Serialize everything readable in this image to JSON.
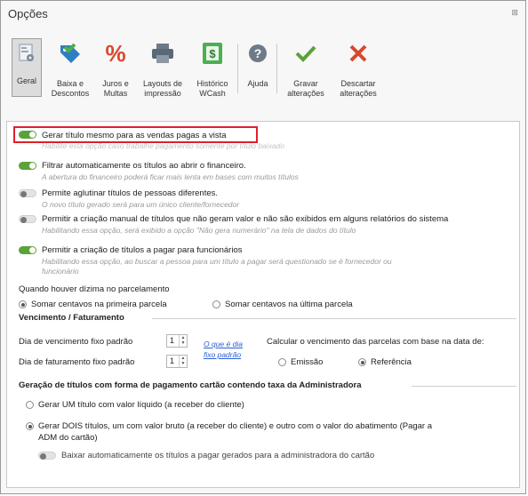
{
  "window": {
    "title": "Opções",
    "close_glyph": "⊠"
  },
  "toolbar": {
    "buttons": [
      {
        "label": "Geral",
        "icon": "general-settings-icon"
      },
      {
        "label": "Baixa e\nDescontos",
        "icon": "discount-tag-icon"
      },
      {
        "label": "Juros e\nMultas",
        "icon": "percent-icon"
      },
      {
        "label": "Layouts de\nimpressão",
        "icon": "printer-icon"
      },
      {
        "label": "Histórico\nWCash",
        "icon": "wcash-icon"
      },
      {
        "label": "Ajuda",
        "icon": "help-icon"
      },
      {
        "label": "Gravar\nalterações",
        "icon": "checkmark-icon"
      },
      {
        "label": "Descartar\nalterações",
        "icon": "cancel-x-icon"
      }
    ]
  },
  "options": [
    {
      "label": "Gerar título mesmo para as vendas pagas a vista",
      "hint": "Habilite esta opção caso trabalhe pagamento somente por título baixado",
      "on": true
    },
    {
      "label": "Filtrar automaticamente os títulos ao abrir o financeiro.",
      "hint": "A abertura do financeiro poderá ficar mais lenta em bases com muitos títulos",
      "on": true
    },
    {
      "label": "Permite aglutinar títulos de pessoas diferentes.",
      "hint": "O novo título gerado será para um único cliente/fornecedor",
      "on": false
    },
    {
      "label": "Permitir a criação manual de títulos que não geram valor e não são exibidos em alguns relatórios do sistema",
      "hint": "Habilitando essa opção, será exibido a opção \"Não gera numerário\" na tela de dados do título",
      "on": false
    },
    {
      "label": "Permitir a criação de títulos a pagar para funcionários",
      "hint": "Habilitando essa opção, ao buscar a pessoa para um título a pagar será questionado se é fornecedor ou",
      "hint2": "funcionário",
      "on": true
    }
  ],
  "dizima": {
    "label": "Quando houver dízima no parcelamento",
    "opt1": "Somar centavos na primeira parcela",
    "opt2": "Somar centavos na última parcela"
  },
  "vencimento": {
    "title": "Vencimento / Faturamento",
    "dia_venc_label": "Dia de vencimento fixo padrão",
    "dia_venc_value": "1",
    "dia_fat_label": "Dia de faturamento fixo padrão",
    "dia_fat_value": "1",
    "link1": "O que é dia",
    "link2": "fixo padrão",
    "calc_label": "Calcular o vencimento das parcelas com base na data de:",
    "emissao": "Emissão",
    "referencia": "Referência"
  },
  "cartao": {
    "title": "Geração de títulos com forma de pagamento cartão contendo taxa da Administradora",
    "opt1": "Gerar UM título com valor líquido (a receber do cliente)",
    "opt2a": "Gerar DOIS títulos, um com valor bruto (a receber do cliente) e outro com o valor do abatimento (Pagar a",
    "opt2b": "ADM do cartão)",
    "baixar": "Baixar automaticamente os títulos a pagar gerados para a administradora do cartão"
  },
  "colors": {
    "accent_green": "#5aa23a",
    "highlight_red": "#e0202a",
    "link_blue": "#2a5fd8"
  }
}
